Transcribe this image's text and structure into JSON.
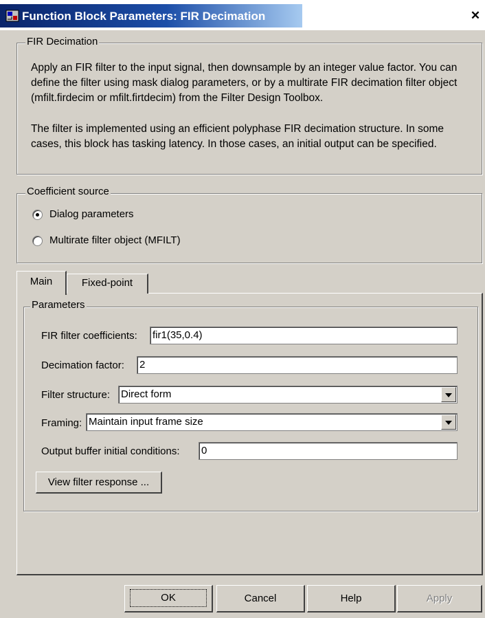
{
  "window": {
    "title": "Function Block Parameters: FIR Decimation",
    "close_glyph": "✕",
    "icon": "simulink-block-icon"
  },
  "block_group": {
    "title": "FIR Decimation",
    "description_1": "Apply an FIR filter to the input signal, then downsample by an integer value factor. You can define the filter using mask dialog parameters, or by a multirate FIR decimation filter object (mfilt.firdecim or mfilt.firtdecim) from the Filter Design Toolbox.",
    "description_2": "The filter is implemented using an efficient polyphase FIR decimation structure. In some cases, this block has tasking latency. In those cases, an initial output can be specified."
  },
  "coefficient_source": {
    "title": "Coefficient source",
    "options": [
      "Dialog parameters",
      "Multirate filter object (MFILT)"
    ],
    "selected": "Dialog parameters"
  },
  "tabs": [
    {
      "label": "Main",
      "active": true
    },
    {
      "label": "Fixed-point",
      "active": false
    }
  ],
  "parameters": {
    "title": "Parameters",
    "fir_coefficients": {
      "label": "FIR filter coefficients:",
      "value": "fir1(35,0.4)"
    },
    "decimation_factor": {
      "label": "Decimation factor:",
      "value": "2"
    },
    "filter_structure": {
      "label": "Filter structure:",
      "value": "Direct form"
    },
    "framing": {
      "label": "Framing:",
      "value": "Maintain input frame size"
    },
    "output_buffer": {
      "label": "Output buffer initial conditions:",
      "value": "0"
    },
    "view_response_label": "View filter response ..."
  },
  "footer": {
    "ok": "OK",
    "cancel": "Cancel",
    "help": "Help",
    "apply": "Apply"
  }
}
